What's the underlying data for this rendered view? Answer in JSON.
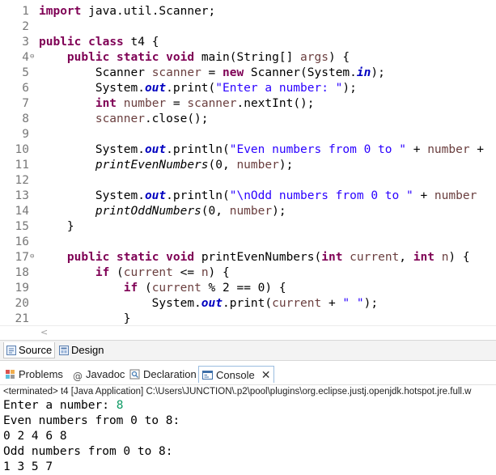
{
  "editor": {
    "lines": [
      {
        "n": "1",
        "fold": "",
        "tokens": [
          {
            "t": "import",
            "c": "kw"
          },
          {
            "t": " java.util.Scanner;",
            "c": ""
          }
        ]
      },
      {
        "n": "2",
        "fold": "",
        "tokens": []
      },
      {
        "n": "3",
        "fold": "",
        "tokens": [
          {
            "t": "public",
            "c": "kw"
          },
          {
            "t": " ",
            "c": ""
          },
          {
            "t": "class",
            "c": "kw"
          },
          {
            "t": " t4 {",
            "c": ""
          }
        ]
      },
      {
        "n": "4",
        "fold": "⊖",
        "tokens": [
          {
            "t": "    ",
            "c": ""
          },
          {
            "t": "public",
            "c": "kw"
          },
          {
            "t": " ",
            "c": ""
          },
          {
            "t": "static",
            "c": "kw"
          },
          {
            "t": " ",
            "c": ""
          },
          {
            "t": "void",
            "c": "kw"
          },
          {
            "t": " main(String[] ",
            "c": ""
          },
          {
            "t": "args",
            "c": "var"
          },
          {
            "t": ") {",
            "c": ""
          }
        ]
      },
      {
        "n": "5",
        "fold": "",
        "tokens": [
          {
            "t": "        Scanner ",
            "c": ""
          },
          {
            "t": "scanner",
            "c": "var"
          },
          {
            "t": " = ",
            "c": ""
          },
          {
            "t": "new",
            "c": "kw"
          },
          {
            "t": " Scanner(System.",
            "c": ""
          },
          {
            "t": "in",
            "c": "fld"
          },
          {
            "t": ");",
            "c": ""
          }
        ]
      },
      {
        "n": "6",
        "fold": "",
        "tokens": [
          {
            "t": "        System.",
            "c": ""
          },
          {
            "t": "out",
            "c": "fld"
          },
          {
            "t": ".print(",
            "c": ""
          },
          {
            "t": "\"Enter a number: \"",
            "c": "str"
          },
          {
            "t": ");",
            "c": ""
          }
        ]
      },
      {
        "n": "7",
        "fold": "",
        "tokens": [
          {
            "t": "        ",
            "c": ""
          },
          {
            "t": "int",
            "c": "kw"
          },
          {
            "t": " ",
            "c": ""
          },
          {
            "t": "number",
            "c": "var"
          },
          {
            "t": " = ",
            "c": ""
          },
          {
            "t": "scanner",
            "c": "var"
          },
          {
            "t": ".nextInt();",
            "c": ""
          }
        ]
      },
      {
        "n": "8",
        "fold": "",
        "tokens": [
          {
            "t": "        ",
            "c": ""
          },
          {
            "t": "scanner",
            "c": "var"
          },
          {
            "t": ".close();",
            "c": ""
          }
        ]
      },
      {
        "n": "9",
        "fold": "",
        "tokens": []
      },
      {
        "n": "10",
        "fold": "",
        "tokens": [
          {
            "t": "        System.",
            "c": ""
          },
          {
            "t": "out",
            "c": "fld"
          },
          {
            "t": ".println(",
            "c": ""
          },
          {
            "t": "\"Even numbers from 0 to \"",
            "c": "str"
          },
          {
            "t": " + ",
            "c": ""
          },
          {
            "t": "number",
            "c": "var"
          },
          {
            "t": " +",
            "c": ""
          }
        ]
      },
      {
        "n": "11",
        "fold": "",
        "tokens": [
          {
            "t": "        ",
            "c": ""
          },
          {
            "t": "printEvenNumbers",
            "c": "it"
          },
          {
            "t": "(0, ",
            "c": ""
          },
          {
            "t": "number",
            "c": "var"
          },
          {
            "t": ");",
            "c": ""
          }
        ]
      },
      {
        "n": "12",
        "fold": "",
        "tokens": []
      },
      {
        "n": "13",
        "fold": "",
        "tokens": [
          {
            "t": "        System.",
            "c": ""
          },
          {
            "t": "out",
            "c": "fld"
          },
          {
            "t": ".println(",
            "c": ""
          },
          {
            "t": "\"\\nOdd numbers from 0 to \"",
            "c": "str"
          },
          {
            "t": " + ",
            "c": ""
          },
          {
            "t": "number",
            "c": "var"
          }
        ]
      },
      {
        "n": "14",
        "fold": "",
        "tokens": [
          {
            "t": "        ",
            "c": ""
          },
          {
            "t": "printOddNumbers",
            "c": "it"
          },
          {
            "t": "(0, ",
            "c": ""
          },
          {
            "t": "number",
            "c": "var"
          },
          {
            "t": ");",
            "c": ""
          }
        ]
      },
      {
        "n": "15",
        "fold": "",
        "tokens": [
          {
            "t": "    }",
            "c": ""
          }
        ]
      },
      {
        "n": "16",
        "fold": "",
        "tokens": []
      },
      {
        "n": "17",
        "fold": "⊖",
        "tokens": [
          {
            "t": "    ",
            "c": ""
          },
          {
            "t": "public",
            "c": "kw"
          },
          {
            "t": " ",
            "c": ""
          },
          {
            "t": "static",
            "c": "kw"
          },
          {
            "t": " ",
            "c": ""
          },
          {
            "t": "void",
            "c": "kw"
          },
          {
            "t": " printEvenNumbers(",
            "c": ""
          },
          {
            "t": "int",
            "c": "kw"
          },
          {
            "t": " ",
            "c": ""
          },
          {
            "t": "current",
            "c": "var"
          },
          {
            "t": ", ",
            "c": ""
          },
          {
            "t": "int",
            "c": "kw"
          },
          {
            "t": " ",
            "c": ""
          },
          {
            "t": "n",
            "c": "var"
          },
          {
            "t": ") {",
            "c": ""
          }
        ]
      },
      {
        "n": "18",
        "fold": "",
        "tokens": [
          {
            "t": "        ",
            "c": ""
          },
          {
            "t": "if",
            "c": "kw"
          },
          {
            "t": " (",
            "c": ""
          },
          {
            "t": "current",
            "c": "var"
          },
          {
            "t": " <= ",
            "c": ""
          },
          {
            "t": "n",
            "c": "var"
          },
          {
            "t": ") {",
            "c": ""
          }
        ]
      },
      {
        "n": "19",
        "fold": "",
        "tokens": [
          {
            "t": "            ",
            "c": ""
          },
          {
            "t": "if",
            "c": "kw"
          },
          {
            "t": " (",
            "c": ""
          },
          {
            "t": "current",
            "c": "var"
          },
          {
            "t": " % 2 == 0) {",
            "c": ""
          }
        ]
      },
      {
        "n": "20",
        "fold": "",
        "tokens": [
          {
            "t": "                System.",
            "c": ""
          },
          {
            "t": "out",
            "c": "fld"
          },
          {
            "t": ".print(",
            "c": ""
          },
          {
            "t": "current",
            "c": "var"
          },
          {
            "t": " + ",
            "c": ""
          },
          {
            "t": "\" \"",
            "c": "str"
          },
          {
            "t": ");",
            "c": ""
          }
        ]
      },
      {
        "n": "21",
        "fold": "",
        "tokens": [
          {
            "t": "            }",
            "c": ""
          }
        ]
      }
    ]
  },
  "editor_tabs": {
    "source_label": "Source",
    "design_label": "Design"
  },
  "views": {
    "problems_label": "Problems",
    "javadoc_label": "Javadoc",
    "declaration_label": "Declaration",
    "console_label": "Console",
    "close_glyph": "✕"
  },
  "console": {
    "status": "<terminated> t4 [Java Application] C:\\Users\\JUNCTION\\.p2\\pool\\plugins\\org.eclipse.justj.openjdk.hotspot.jre.full.w",
    "prompt": "Enter a number: ",
    "input_value": "8",
    "line2": "Even numbers from 0 to 8:",
    "line3": "0 2 4 6 8",
    "line4": "Odd numbers from 0 to 8:",
    "line5": "1 3 5 7"
  },
  "colors": {
    "keyword": "#7f0055",
    "string": "#2a00ff",
    "field": "#0000c0",
    "local_var": "#6a3e3e",
    "console_input": "#0d9a64"
  }
}
